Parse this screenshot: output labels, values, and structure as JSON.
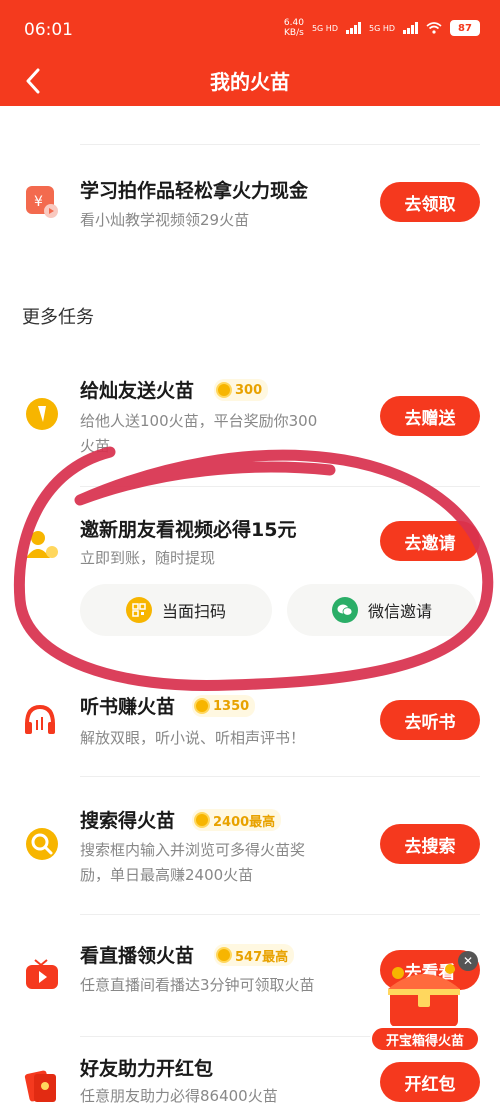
{
  "status_bar": {
    "time": "06:01",
    "net_speed_value": "6.40",
    "net_speed_unit": "KB/s",
    "sim1": "5G HD",
    "sim2": "5G HD",
    "battery": "87"
  },
  "nav": {
    "title": "我的火苗"
  },
  "tasks": {
    "study": {
      "title": "学习拍作品轻松拿火力现金",
      "desc": "看小灿教学视频领29火苗",
      "button": "去领取"
    },
    "send": {
      "title": "给灿友送火苗",
      "badge": "300",
      "desc_line1": "给他人送100火苗，平台奖励你300",
      "desc_line2": "火苗",
      "button": "去赠送"
    },
    "invite": {
      "title": "邀新朋友看视频必得15元",
      "desc": "立即到账，随时提现",
      "button": "去邀请",
      "scan_label": "当面扫码",
      "wechat_label": "微信邀请"
    },
    "listen": {
      "title": "听书赚火苗",
      "badge": "1350",
      "desc": "解放双眼，听小说、听相声评书！",
      "button": "去听书"
    },
    "search": {
      "title": "搜索得火苗",
      "badge": "2400最高",
      "desc_line1": "搜索框内输入并浏览可多得火苗奖",
      "desc_line2": "励，单日最高赚2400火苗",
      "button": "去搜索"
    },
    "live": {
      "title": "看直播领火苗",
      "badge": "547最高",
      "desc": "任意直播间看播达3分钟可领取火苗",
      "button": "去看看"
    },
    "redpacket": {
      "title": "好友助力开红包",
      "desc": "任意朋友助力必得86400火苗",
      "button": "开红包"
    }
  },
  "section": {
    "more_tasks": "更多任务"
  },
  "treasure": {
    "label": "开宝箱得火苗"
  },
  "colors": {
    "brand_red": "#f43a1e",
    "button_red": "#f5391e",
    "coin_gold": "#f7b500",
    "annotation_pink": "#d8324f",
    "wechat_green": "#2aae67"
  }
}
